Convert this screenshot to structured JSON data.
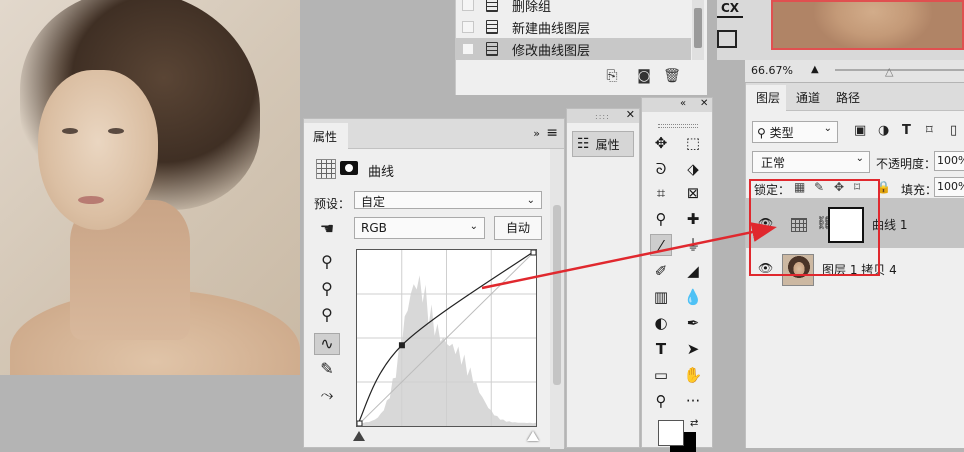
{
  "history": {
    "items": [
      {
        "label": "删除组"
      },
      {
        "label": "新建曲线图层"
      },
      {
        "label": "修改曲线图层",
        "selected": true
      }
    ]
  },
  "mini_panel": {
    "label": "属性"
  },
  "properties": {
    "tab": "属性",
    "title": "曲线",
    "preset_label": "预设：",
    "preset_value": "自定",
    "channel_value": "RGB",
    "auto_button": "自动"
  },
  "curve_chart": {
    "type": "line",
    "points": [
      [
        0,
        0
      ],
      [
        64,
        117
      ],
      [
        255,
        255
      ]
    ],
    "xlim": [
      0,
      255
    ],
    "ylim": [
      0,
      255
    ]
  },
  "right_top": {
    "cx_label": "CX"
  },
  "zoom": {
    "value": "66.67%"
  },
  "layers_panel": {
    "tabs": [
      "图层",
      "通道",
      "路径"
    ],
    "filter_value": "类型",
    "blend_value": "正常",
    "opacity_label": "不透明度：",
    "opacity_value": "100%",
    "lock_label": "锁定：",
    "fill_label": "填充：",
    "fill_value": "100%",
    "layers": [
      {
        "name": "曲线 1",
        "selected": true
      },
      {
        "name": "图层 1 拷贝 4",
        "selected": false
      }
    ]
  },
  "colors": {
    "highlight": "#e0282e",
    "panel_bg": "#efefef",
    "canvas_bg": "#b4b4b4"
  },
  "icons": {
    "tools": [
      "move-icon",
      "marquee-icon",
      "lasso-icon",
      "object-select-icon",
      "crop-icon",
      "frame-icon",
      "eyedropper-icon",
      "healing-icon",
      "brush-icon",
      "stamp-icon",
      "history-brush-icon",
      "eraser-icon",
      "gradient-icon",
      "blur-icon",
      "dodge-icon",
      "pen-icon",
      "type-icon",
      "path-select-icon",
      "rectangle-icon",
      "hand-icon",
      "zoom-icon",
      "more-icon"
    ]
  }
}
